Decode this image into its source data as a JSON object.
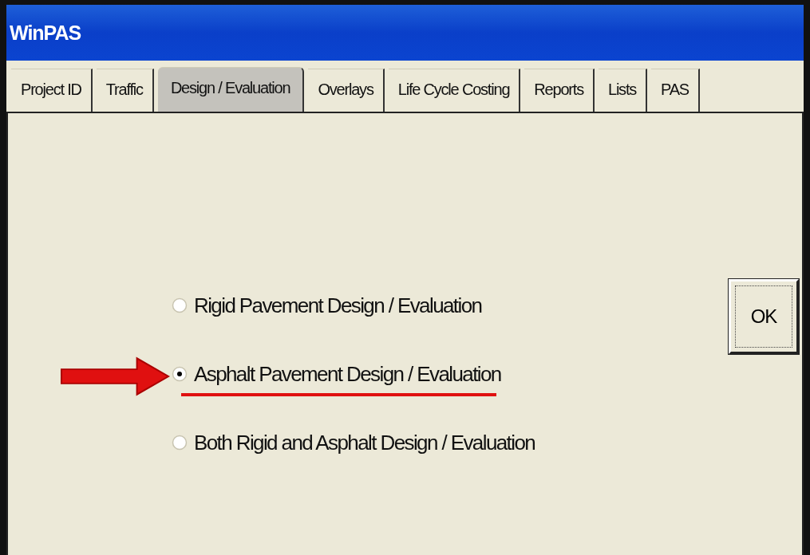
{
  "window": {
    "title": "WinPAS"
  },
  "tabs": [
    {
      "label": "Project ID",
      "selected": false
    },
    {
      "label": "Traffic",
      "selected": false
    },
    {
      "label": "Design / Evaluation",
      "selected": true
    },
    {
      "label": "Overlays",
      "selected": false
    },
    {
      "label": "Life Cycle Costing",
      "selected": false
    },
    {
      "label": "Reports",
      "selected": false
    },
    {
      "label": "Lists",
      "selected": false
    },
    {
      "label": "PAS",
      "selected": false
    }
  ],
  "options": [
    {
      "label": "Rigid Pavement Design / Evaluation",
      "selected": false,
      "highlighted": false
    },
    {
      "label": "Asphalt Pavement Design / Evaluation",
      "selected": true,
      "highlighted": true
    },
    {
      "label": "Both Rigid and Asphalt Design / Evaluation",
      "selected": false,
      "highlighted": false
    }
  ],
  "buttons": [
    {
      "label": "OK"
    }
  ]
}
